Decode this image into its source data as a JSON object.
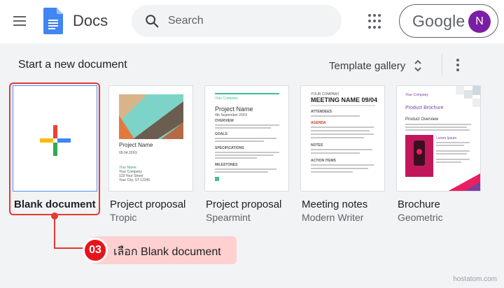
{
  "header": {
    "app_title": "Docs",
    "search_placeholder": "Search",
    "account_brand": "Google",
    "avatar_initial": "N"
  },
  "main": {
    "section_title": "Start a new document",
    "gallery_label": "Template gallery",
    "templates": [
      {
        "name": "Blank document",
        "subtitle": ""
      },
      {
        "name": "Project proposal",
        "subtitle": "Tropic"
      },
      {
        "name": "Project proposal",
        "subtitle": "Spearmint"
      },
      {
        "name": "Meeting notes",
        "subtitle": "Modern Writer"
      },
      {
        "name": "Brochure",
        "subtitle": "Geometric"
      }
    ]
  },
  "thumbnails": {
    "tropic": {
      "title": "Project Name",
      "date": "09.04.20XX",
      "footer": [
        "Your Name",
        "Your Company",
        "123 Your Street",
        "Your City, ST 12345"
      ]
    },
    "spearmint": {
      "company": "Your Company",
      "title": "Project Name",
      "date": "4th September 20XX",
      "sections": [
        "OVERVIEW",
        "GOALS",
        "SPECIFICATIONS",
        "MILESTONES"
      ]
    },
    "meeting": {
      "label": "YOUR COMPANY",
      "title": "MEETING NAME 09/04",
      "sections": [
        "ATTENDEES",
        "AGENDA",
        "NOTES",
        "ACTION ITEMS"
      ]
    },
    "brochure": {
      "company": "Your Company",
      "title": "Product Brochure",
      "subtitle": "Product Overview",
      "feature": "Lorem Ipsum"
    }
  },
  "annotation": {
    "step_number": "03",
    "instruction": "เลือก Blank document"
  },
  "watermark": "hostatom.com",
  "colors": {
    "highlight": "#e53935",
    "callout_bg": "#ffd0d0",
    "avatar": "#7b1fa2",
    "docs_blue": "#4285f4",
    "page_bg": "#f1f3f4"
  },
  "icons": [
    "menu-icon",
    "docs-logo-icon",
    "search-icon",
    "apps-icon",
    "unfold-icon",
    "more-vert-icon",
    "plus-icon"
  ]
}
